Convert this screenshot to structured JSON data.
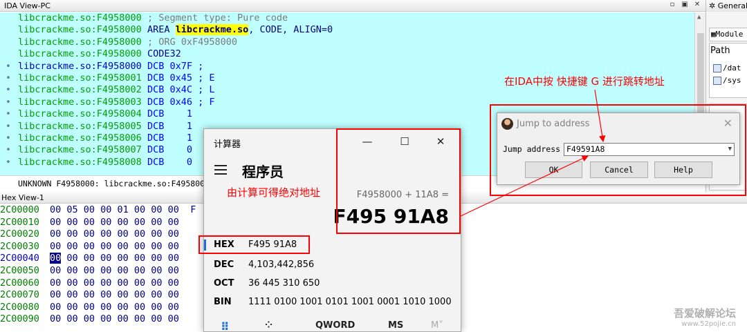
{
  "ida_view": {
    "title": "IDA View-PC",
    "lines": [
      {
        "addr": "libcrackme.so:F4958000",
        "rest": " ; Segment type: Pure code",
        "style": "comment",
        "dot": false
      },
      {
        "addr": "libcrackme.so:F4958000",
        "rest": " AREA ",
        "hl": "libcrackme.so",
        "tail": ", CODE, ALIGN=0",
        "style": "area",
        "dot": false
      },
      {
        "addr": "libcrackme.so:F4958000",
        "rest": " ; ORG 0xF4958000",
        "style": "comment",
        "dot": false
      },
      {
        "addr": "libcrackme.so:F4958000",
        "rest": " CODE32",
        "style": "plain",
        "dot": false
      },
      {
        "addr": "libcrackme.so:F4958000",
        "rest": " DCB 0x7F ;",
        "style": "dcb",
        "dot": true,
        "blue": true
      },
      {
        "addr": "libcrackme.so:F4958001",
        "rest": " DCB 0x45 ; E",
        "style": "dcb",
        "dot": true
      },
      {
        "addr": "libcrackme.so:F4958002",
        "rest": " DCB 0x4C ; L",
        "style": "dcb",
        "dot": true
      },
      {
        "addr": "libcrackme.so:F4958003",
        "rest": " DCB 0x46 ; F",
        "style": "dcb",
        "dot": true
      },
      {
        "addr": "libcrackme.so:F4958004",
        "rest": " DCB    1",
        "style": "dcb",
        "dot": true
      },
      {
        "addr": "libcrackme.so:F4958005",
        "rest": " DCB    1",
        "style": "dcb",
        "dot": true
      },
      {
        "addr": "libcrackme.so:F4958006",
        "rest": " DCB    1",
        "style": "dcb",
        "dot": true
      },
      {
        "addr": "libcrackme.so:F4958007",
        "rest": " DCB    0",
        "style": "dcb",
        "dot": true
      },
      {
        "addr": "libcrackme.so:F4958008",
        "rest": " DCB    0",
        "style": "dcb",
        "dot": true
      }
    ],
    "status_line": "UNKNOWN F4958000: libcrackme.so:F495800"
  },
  "right_panel": {
    "title": "General",
    "tab": "Module",
    "header": "Path",
    "rows": [
      "/dat",
      "/sys"
    ]
  },
  "hex_view": {
    "title": "Hex View-1",
    "rows": [
      {
        "addr": "2C00000",
        "bytes": "00 05 00 00 01 00 00 00  F"
      },
      {
        "addr": "2C00010",
        "bytes": "00 00 00 00 00 00 00 00"
      },
      {
        "addr": "2C00020",
        "bytes": "00 00 00 00 00 00 00 00"
      },
      {
        "addr": "2C00030",
        "bytes": "00 00 00 00 00 00 00 00"
      },
      {
        "addr": "2C00040",
        "bytes": "00 00 00 00 00 00 00 00",
        "selected": true
      },
      {
        "addr": "2C00050",
        "bytes": "00 00 00 00 00 00 00 00"
      },
      {
        "addr": "2C00060",
        "bytes": "00 00 00 00 00 00 00 00"
      },
      {
        "addr": "2C00070",
        "bytes": "00 00 00 00 00 00 00 00"
      },
      {
        "addr": "2C00080",
        "bytes": "00 00 00 00 00 00 00 00"
      },
      {
        "addr": "2C00090",
        "bytes": "00 00 00 00 00 00 00 00"
      }
    ]
  },
  "calculator": {
    "title": "计算器",
    "mode": "程序员",
    "expression": "F4958000 + 11A8 =",
    "result": "F495 91A8",
    "bases": [
      {
        "label": "HEX",
        "value": "F495 91A8"
      },
      {
        "label": "DEC",
        "value": "4,103,442,856"
      },
      {
        "label": "OCT",
        "value": "36 445 310 650"
      },
      {
        "label": "BIN",
        "value": "1111 0100 1001 0101 1001 0001 1010 1000"
      }
    ],
    "word_size": "QWORD",
    "ms": "MS",
    "mplus": "M˅"
  },
  "jump_dialog": {
    "title": "Jump to address",
    "label": "Jump address",
    "value": "F49591A8",
    "ok": "OK",
    "cancel": "Cancel",
    "help": "Help"
  },
  "annotations": {
    "calc_note": "由计算可得绝对地址",
    "jump_note": "在IDA中按 快捷键 G 进行跳转地址",
    "color": "#ff0000"
  },
  "watermark": {
    "line1": "吾爱破解论坛",
    "line2": "www.52pojie.cn"
  }
}
